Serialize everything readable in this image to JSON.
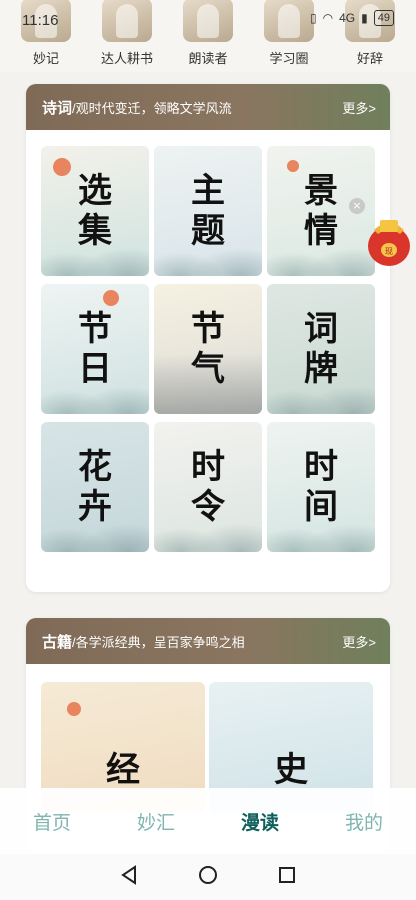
{
  "status_bar": {
    "time": "11:16",
    "signal_text": "4G",
    "battery": "49"
  },
  "categories": [
    {
      "label": "妙记"
    },
    {
      "label": "达人耕书"
    },
    {
      "label": "朗读者"
    },
    {
      "label": "学习圈"
    },
    {
      "label": "好辞"
    }
  ],
  "poetry": {
    "title": "诗词",
    "subtitle": "/观时代变迁，领略文学风流",
    "more": "更多>",
    "tiles": [
      {
        "label": "选集"
      },
      {
        "label": "主题"
      },
      {
        "label": "景情"
      },
      {
        "label": "节日"
      },
      {
        "label": "节气"
      },
      {
        "label": "词牌"
      },
      {
        "label": "花卉"
      },
      {
        "label": "时令"
      },
      {
        "label": "时间"
      }
    ]
  },
  "classics": {
    "title": "古籍",
    "subtitle": "/各学派经典，呈百家争鸣之相",
    "more": "更多>",
    "tiles": [
      {
        "label": "经"
      },
      {
        "label": "史"
      }
    ]
  },
  "float_widget": {
    "close_glyph": "×",
    "envelope_text": "现"
  },
  "bottom_nav": [
    {
      "label": "首页"
    },
    {
      "label": "妙汇"
    },
    {
      "label": "漫读"
    },
    {
      "label": "我的"
    }
  ]
}
